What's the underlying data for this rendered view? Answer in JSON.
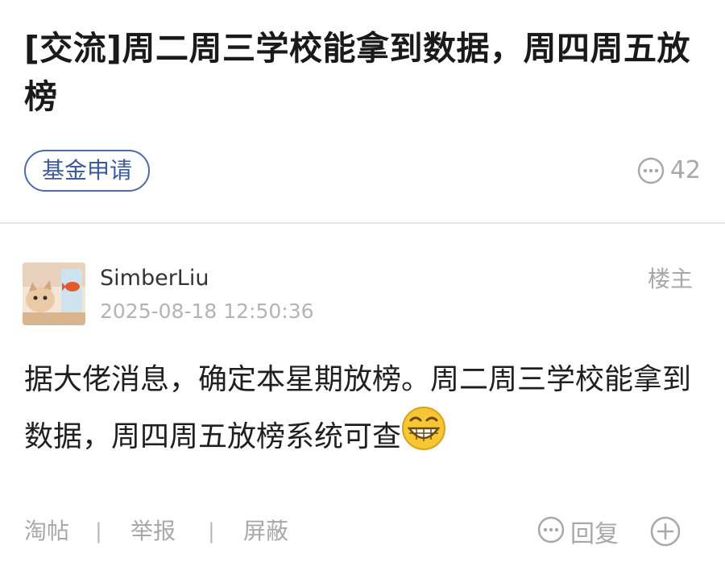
{
  "thread": {
    "title": "[交流]周二周三学校能拿到数据，周四周五放榜",
    "category_tag": "基金申请",
    "comment_count": "42"
  },
  "post": {
    "author": "SimberLiu",
    "timestamp": "2025-08-18 12:50:36",
    "role_badge": "楼主",
    "body": "据大佬消息，确定本星期放榜。周二周三学校能拿到数据，周四周五放榜系统可查",
    "emoji": "grinning-face-icon"
  },
  "actions": {
    "tao_tie": "淘帖",
    "report": "举报",
    "block": "屏蔽",
    "reply": "回复",
    "separator": "|"
  },
  "colors": {
    "tag_blue": "#3d5a9c",
    "muted_gray": "#a8a8a8",
    "divider": "#e6e6e6"
  }
}
